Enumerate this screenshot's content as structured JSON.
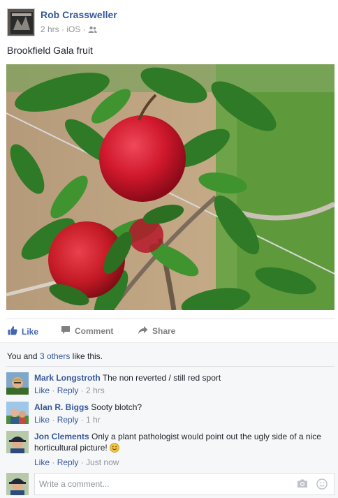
{
  "post": {
    "author": "Rob Crassweller",
    "time": "2 hrs",
    "separator1": "·",
    "source": "iOS",
    "separator2": "·",
    "audience_icon": "friends-icon",
    "text": "Brookfield Gala fruit",
    "photo_subject": "red-apples-on-branch"
  },
  "actions": {
    "like": "Like",
    "comment": "Comment",
    "share": "Share"
  },
  "likes": {
    "prefix": "You and ",
    "others": "3 others",
    "suffix": " like this."
  },
  "comments": [
    {
      "author": "Mark Longstroth",
      "text": "The non reverted / still red sport",
      "like": "Like",
      "reply": "Reply",
      "time": "2 hrs"
    },
    {
      "author": "Alan R. Biggs",
      "text": "Sooty blotch?",
      "like": "Like",
      "reply": "Reply",
      "time": "1 hr"
    },
    {
      "author": "Jon Clements",
      "text": "Only a plant pathologist would point out the ugly side of a nice horticultural picture!",
      "like": "Like",
      "reply": "Reply",
      "time": "Just now"
    }
  ],
  "composer": {
    "placeholder": "Write a comment...",
    "camera_icon": "camera-icon",
    "emoji_icon": "smiley-icon"
  },
  "colors": {
    "link": "#365899",
    "like_active": "#4267b2",
    "meta_gray": "#90949c",
    "ufi_background": "#f6f7f9"
  }
}
